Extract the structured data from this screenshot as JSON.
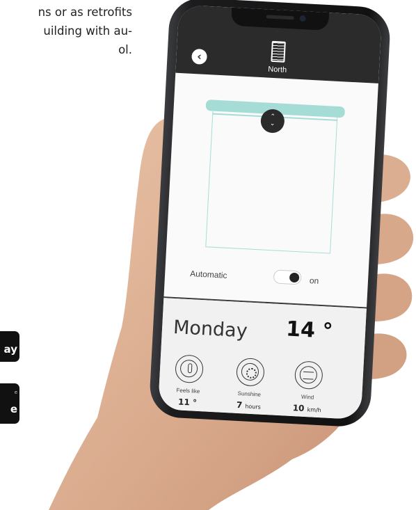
{
  "background": {
    "text_lines": [
      "ns or as retrofits",
      "uilding with au-",
      "ol."
    ],
    "store_badges": [
      {
        "small": "",
        "big": "ay"
      },
      {
        "small": "e",
        "big": "e"
      }
    ]
  },
  "app": {
    "header": {
      "back_icon": "chevron-left-icon",
      "blind_icon": "blind-icon",
      "title": "North"
    },
    "blind": {
      "up_glyph": "⌃",
      "down_glyph": "⌄"
    },
    "automatic": {
      "label": "Automatic",
      "state": "on"
    },
    "weather": {
      "day": "Monday",
      "temperature": "14 °",
      "items": [
        {
          "icon": "thermometer-icon",
          "label": "Feels like",
          "value": "11 °",
          "unit": ""
        },
        {
          "icon": "sun-icon",
          "label": "Sunshine",
          "value": "7",
          "unit": "hours"
        },
        {
          "icon": "wind-icon",
          "label": "Wind",
          "value": "10",
          "unit": "km/h"
        }
      ]
    },
    "colors": {
      "accent": "#a6dcd6",
      "header": "#2b2b2b"
    }
  }
}
